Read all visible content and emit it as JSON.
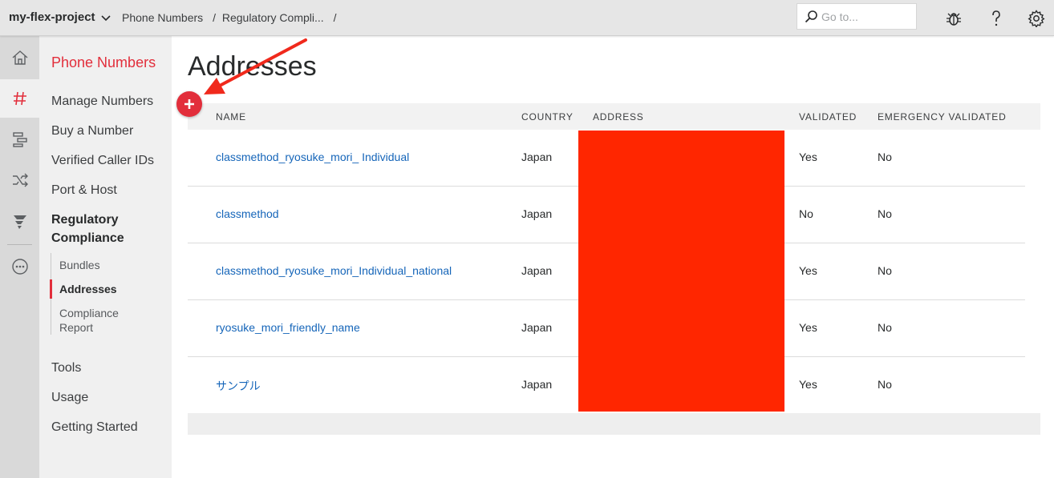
{
  "header": {
    "project": "my-flex-project",
    "breadcrumbs": [
      "Phone Numbers",
      "Regulatory Compli..."
    ],
    "breadcrumb_trailing_sep": "/",
    "search_placeholder": "Go to...",
    "icons": [
      "search-icon",
      "bug-icon",
      "help-icon",
      "gear-icon"
    ]
  },
  "rail": {
    "items": [
      "home-icon",
      "hash-icon",
      "studio-icon",
      "shuffle-icon",
      "flex-icon",
      "more-icon"
    ]
  },
  "sidebar": {
    "title": "Phone Numbers",
    "links": {
      "manage": "Manage Numbers",
      "buy": "Buy a Number",
      "verified": "Verified Caller IDs",
      "port": "Port & Host",
      "regulatory_line1": "Regulatory",
      "regulatory_line2": "Compliance",
      "tools": "Tools",
      "usage": "Usage",
      "getting_started": "Getting Started"
    },
    "sub": {
      "bundles": "Bundles",
      "addresses": "Addresses",
      "report_line1": "Compliance",
      "report_line2": "Report"
    }
  },
  "main": {
    "title": "Addresses",
    "columns": {
      "name": "NAME",
      "country": "COUNTRY",
      "address": "ADDRESS",
      "validated": "VALIDATED",
      "emergency": "EMERGENCY VALIDATED"
    },
    "rows": [
      {
        "name": "classmethod_ryosuke_mori_ Individual",
        "country": "Japan",
        "validated": "Yes",
        "emergency": "No"
      },
      {
        "name": "classmethod",
        "country": "Japan",
        "validated": "No",
        "emergency": "No"
      },
      {
        "name": "classmethod_ryosuke_mori_Individual_national",
        "country": "Japan",
        "validated": "Yes",
        "emergency": "No"
      },
      {
        "name": "ryosuke_mori_friendly_name",
        "country": "Japan",
        "validated": "Yes",
        "emergency": "No"
      },
      {
        "name": "サンプル",
        "country": "Japan",
        "validated": "Yes",
        "emergency": "No"
      }
    ]
  },
  "colors": {
    "accent": "#e22e3b",
    "link": "#1565b9",
    "redaction": "#ff2600",
    "annotation_arrow": "#f0291c"
  }
}
